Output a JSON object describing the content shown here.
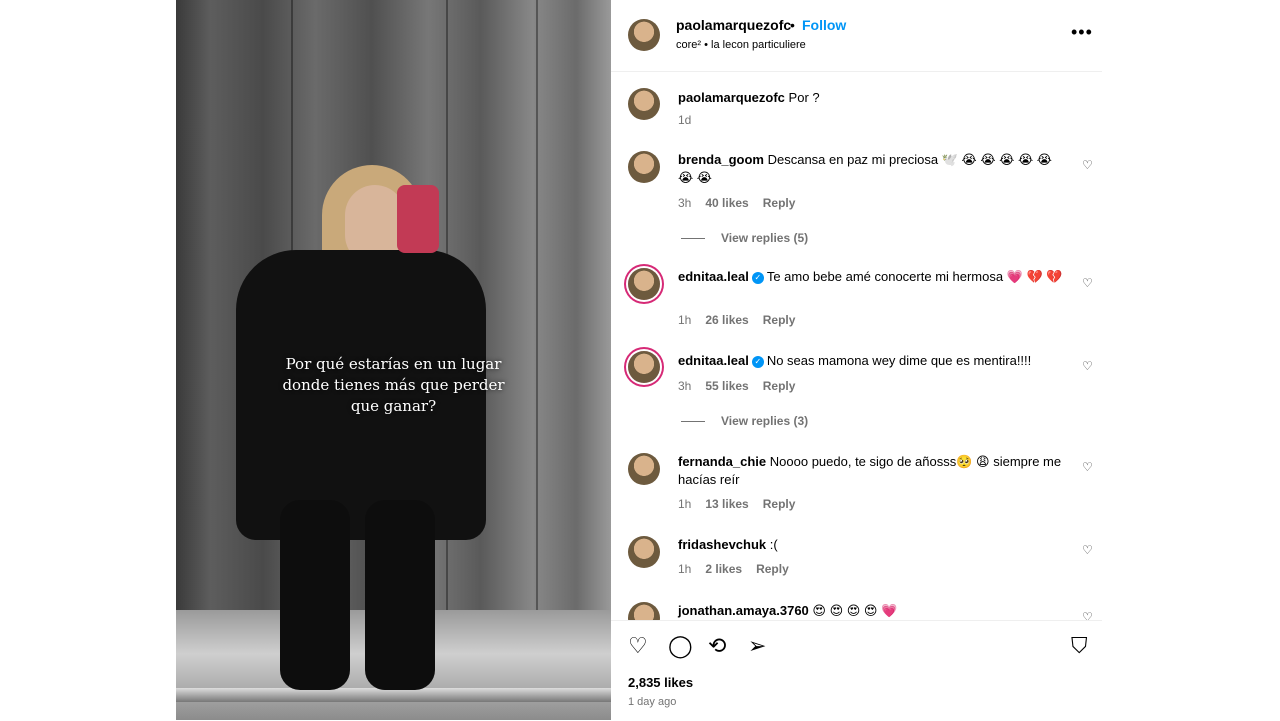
{
  "photo": {
    "overlay_lines": [
      "Por qué estarías en un lugar",
      "donde tienes más que perder",
      "que ganar?"
    ]
  },
  "header": {
    "username": "paolamarquezofc",
    "separator": "•",
    "follow": "Follow",
    "subtitle": "core² • la lecon particuliere",
    "more": "•••"
  },
  "caption": {
    "username": "paolamarquezofc",
    "text": "Por ?",
    "time": "1d"
  },
  "comments": [
    {
      "username": "brenda_goom",
      "verified": false,
      "text": "Descansa en paz mi preciosa 🕊️ 😭 😭 😭 😭 😭 😭 😭",
      "time": "3h",
      "likes": "40 likes",
      "reply": "Reply",
      "view_replies": "View replies (5)"
    },
    {
      "username": "ednitaa.leal",
      "verified": true,
      "text": "Te amo bebe amé conocerte mi hermosa 💗 💔 💔",
      "time": "1h",
      "likes": "26 likes",
      "reply": "Reply",
      "view_replies": ""
    },
    {
      "username": "ednitaa.leal",
      "verified": true,
      "text": "No seas mamona wey dime que es mentira!!!!",
      "time": "3h",
      "likes": "55 likes",
      "reply": "Reply",
      "view_replies": "View replies (3)"
    },
    {
      "username": "fernanda_chie",
      "verified": false,
      "text": "Noooo puedo, te sigo de añosss🥺 😩 siempre me hacías reír",
      "time": "1h",
      "likes": "13 likes",
      "reply": "Reply",
      "view_replies": ""
    },
    {
      "username": "fridashevchuk",
      "verified": false,
      "text": ":(",
      "time": "1h",
      "likes": "2 likes",
      "reply": "Reply",
      "view_replies": ""
    },
    {
      "username": "jonathan.amaya.3760",
      "verified": false,
      "text": "😍 😍 😍 😍 💗",
      "time": "",
      "likes": "",
      "reply": "",
      "view_replies": ""
    }
  ],
  "actions": {
    "like_icon": "♡",
    "comment_icon": "◯",
    "repost_icon": "⟲",
    "share_icon": "➢",
    "save_icon": "⛉"
  },
  "footer": {
    "likes": "2,835 likes",
    "time": "1 day ago"
  }
}
